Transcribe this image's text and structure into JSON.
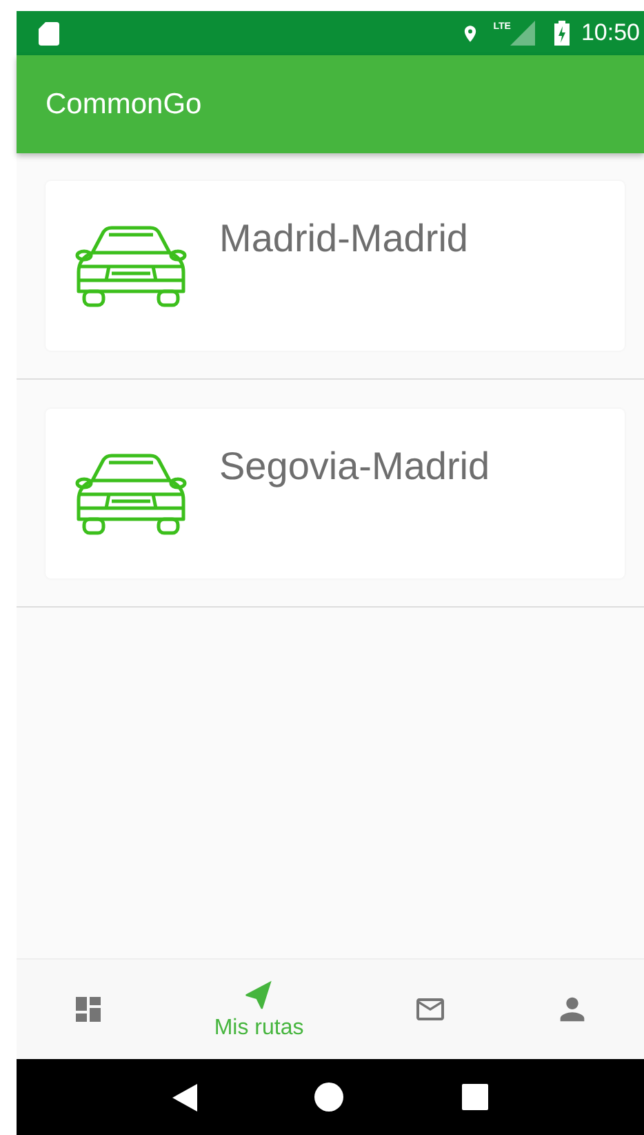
{
  "status_bar": {
    "time": "10:50",
    "network": "LTE"
  },
  "app_bar": {
    "title": "CommonGo"
  },
  "routes": [
    {
      "name": "Madrid-Madrid"
    },
    {
      "name": "Segovia-Madrid"
    }
  ],
  "bottom_nav": [
    {
      "kind": "dashboard",
      "selected": false
    },
    {
      "kind": "navigation",
      "selected": true,
      "label": "Mis rutas"
    },
    {
      "kind": "mail",
      "selected": false
    },
    {
      "kind": "person",
      "selected": false
    }
  ]
}
